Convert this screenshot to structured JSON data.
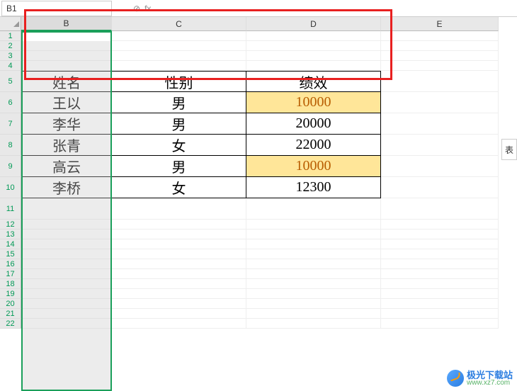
{
  "formula_bar": {
    "name_box": "B1",
    "fx_label": "fx"
  },
  "columns": [
    "B",
    "C",
    "D",
    "E"
  ],
  "rows": [
    "1",
    "2",
    "3",
    "4",
    "5",
    "6",
    "7",
    "8",
    "9",
    "10",
    "11",
    "12",
    "13",
    "14",
    "15",
    "16",
    "17",
    "18",
    "19",
    "20",
    "21",
    "22"
  ],
  "table": {
    "headers": {
      "name": "姓名",
      "gender": "性别",
      "performance": "绩效"
    },
    "data": [
      {
        "name": "王以",
        "gender": "男",
        "performance": "10000",
        "hl": true
      },
      {
        "name": "李华",
        "gender": "男",
        "performance": "20000",
        "hl": false
      },
      {
        "name": "张青",
        "gender": "女",
        "performance": "22000",
        "hl": false
      },
      {
        "name": "高云",
        "gender": "男",
        "performance": "10000",
        "hl": true
      },
      {
        "name": "李桥",
        "gender": "女",
        "performance": "12300",
        "hl": false
      }
    ]
  },
  "side_tab": "表",
  "watermark": {
    "title": "极光下载站",
    "url": "www.xz7.com"
  },
  "chart_data": {
    "type": "table",
    "title": "",
    "columns": [
      "姓名",
      "性别",
      "绩效"
    ],
    "rows": [
      [
        "王以",
        "男",
        10000
      ],
      [
        "李华",
        "男",
        20000
      ],
      [
        "张青",
        "女",
        22000
      ],
      [
        "高云",
        "男",
        10000
      ],
      [
        "李桥",
        "女",
        12300
      ]
    ]
  }
}
